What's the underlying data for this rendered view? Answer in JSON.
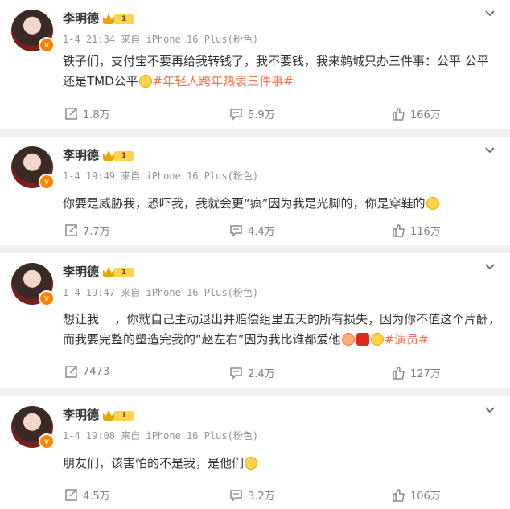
{
  "colors": {
    "accent_tag": "#eb7350",
    "verified": "#ff8200",
    "crown": "#e8a600"
  },
  "posts": [
    {
      "author": "李明德",
      "level": "1",
      "meta": "1-4 21:34 来自 iPhone 16 Plus(粉色)",
      "content_line1": "铁子们，支付宝不要再给我转钱了，我不要钱，我来鹈城只办三件事：公平 公平",
      "content_line2a": "还是TMD公平",
      "content_tag": "#年轻人跨年热衷三件事#",
      "repost": "1.8万",
      "comment": "5.9万",
      "like": "166万"
    },
    {
      "author": "李明德",
      "level": "1",
      "meta": "1-4 19:49 来自 iPhone 16 Plus(粉色)",
      "content_line1": "你要是威胁我，恐吓我，我就会更“疯”因为我是光脚的，你是穿鞋的",
      "repost": "7.7万",
      "comment": "4.4万",
      "like": "116万"
    },
    {
      "author": "李明德",
      "level": "1",
      "meta": "1-4 19:47 来自 iPhone 16 Plus(粉色)",
      "content_line1": "想让我    ，你就自己主动退出并赔偿组里五天的所有损失，因为你不值这个片酬，",
      "content_line2a": "而我要完整的塑造完我的“赵左右”因为我比谁都爱他",
      "content_tag": "#演员#",
      "repost": "7473",
      "comment": "2.4万",
      "like": "127万"
    },
    {
      "author": "李明德",
      "level": "1",
      "meta": "1-4 19:08 来自 iPhone 16 Plus(粉色)",
      "content_line1": "朋友们，该害怕的不是我，是他们",
      "repost": "4.5万",
      "comment": "3.2万",
      "like": "106万"
    }
  ]
}
